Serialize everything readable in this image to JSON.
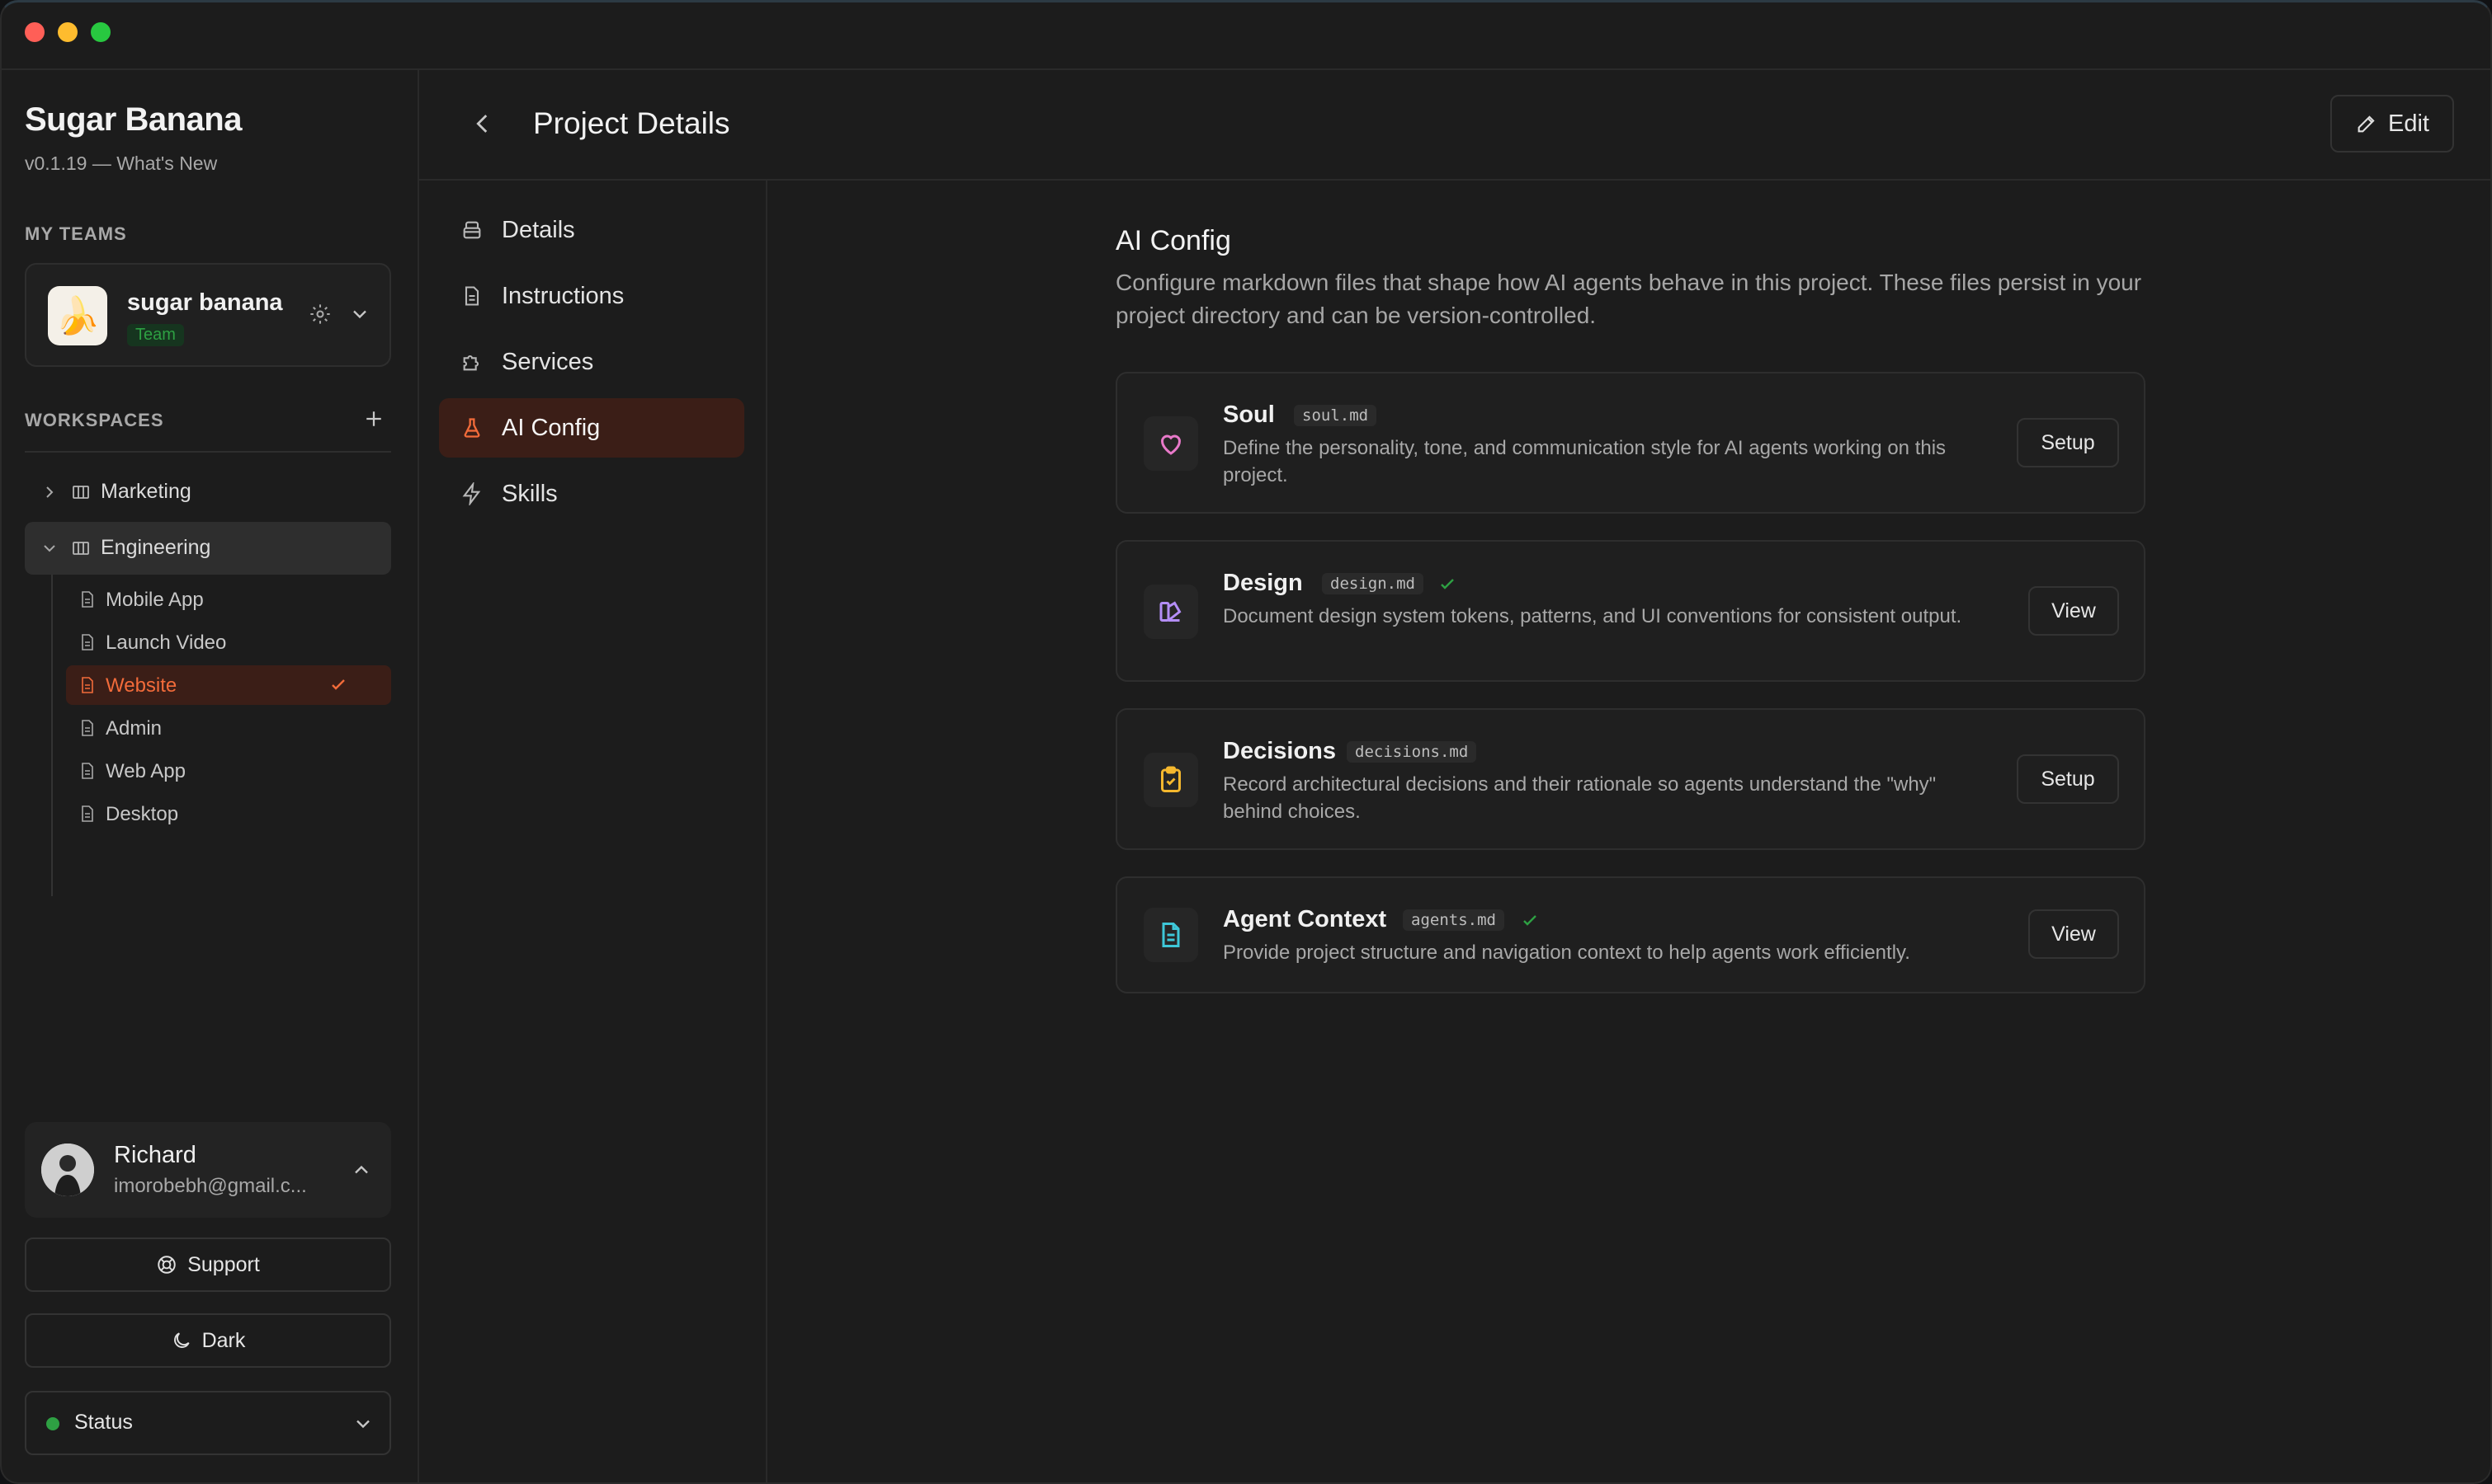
{
  "app": {
    "name": "Sugar Banana",
    "version": "v0.1.19 — What's New"
  },
  "sidebar": {
    "my_teams_label": "MY TEAMS",
    "team": {
      "name": "sugar banana",
      "badge": "Team",
      "logo_emoji": "🍌"
    },
    "workspaces_label": "WORKSPACES",
    "workspaces": [
      {
        "label": "Marketing",
        "expanded": false
      },
      {
        "label": "Engineering",
        "expanded": true
      }
    ],
    "projects": [
      {
        "label": "Mobile App",
        "active": false
      },
      {
        "label": "Launch Video",
        "active": false
      },
      {
        "label": "Website",
        "active": true
      },
      {
        "label": "Admin",
        "active": false
      },
      {
        "label": "Web App",
        "active": false
      },
      {
        "label": "Desktop",
        "active": false
      }
    ],
    "user": {
      "name": "Richard",
      "email": "imorobebh@gmail.c..."
    },
    "support_label": "Support",
    "theme_label": "Dark",
    "status_label": "Status"
  },
  "header": {
    "title": "Project Details",
    "edit_label": "Edit"
  },
  "subnav": {
    "items": [
      {
        "label": "Details",
        "icon": "archive-icon"
      },
      {
        "label": "Instructions",
        "icon": "document-icon"
      },
      {
        "label": "Services",
        "icon": "puzzle-icon"
      },
      {
        "label": "AI Config",
        "icon": "flask-icon",
        "active": true
      },
      {
        "label": "Skills",
        "icon": "lightning-icon"
      }
    ]
  },
  "ai_config": {
    "title": "AI Config",
    "description": "Configure markdown files that shape how AI agents behave in this project. These files persist in your project directory and can be version-controlled.",
    "cards": [
      {
        "title": "Soul",
        "file": "soul.md",
        "configured": false,
        "description": "Define the personality, tone, and communication style for AI agents working on this project.",
        "action": "Setup",
        "icon": "heart-icon",
        "icon_color": "#e879c9"
      },
      {
        "title": "Design",
        "file": "design.md",
        "configured": true,
        "description": "Document design system tokens, patterns, and UI conventions for consistent output.",
        "action": "View",
        "icon": "swatch-icon",
        "icon_color": "#b48ef7"
      },
      {
        "title": "Decisions",
        "file": "decisions.md",
        "configured": false,
        "description": "Record architectural decisions and their rationale so agents understand the \"why\" behind choices.",
        "action": "Setup",
        "icon": "clipboard-check-icon",
        "icon_color": "#f5b82e"
      },
      {
        "title": "Agent Context",
        "file": "agents.md",
        "configured": true,
        "description": "Provide project structure and navigation context to help agents work efficiently.",
        "action": "View",
        "icon": "file-text-icon",
        "icon_color": "#3ec7d8"
      }
    ]
  },
  "colors": {
    "accent": "#f26b3a",
    "active_bg": "#3b1e17",
    "success": "#2ea043"
  }
}
